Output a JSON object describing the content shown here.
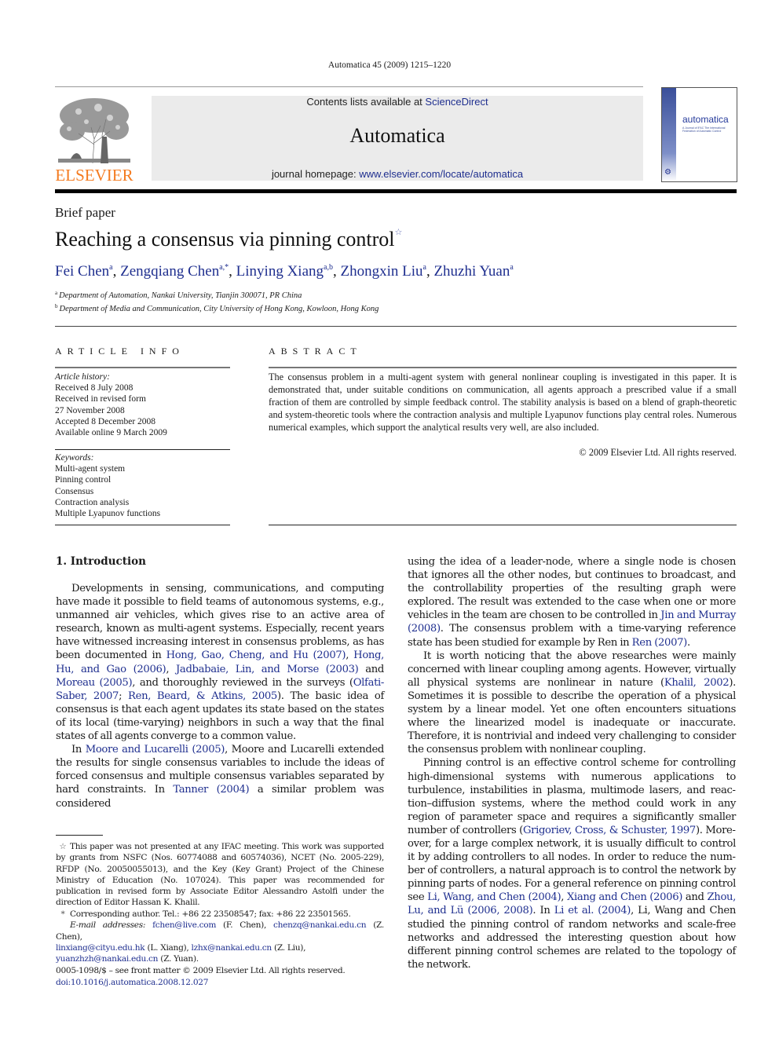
{
  "running_head": "Automatica 45 (2009) 1215–1220",
  "masthead": {
    "publisher_logo_text": "ELSEVIER",
    "contents_prefix": "Contents lists available at ",
    "contents_link": "ScienceDirect",
    "journal_name": "Automatica",
    "homepage_prefix": "journal homepage: ",
    "homepage_link": "www.elsevier.com/locate/automatica",
    "cover_title": "automatica",
    "cover_subtitle": "A Journal of IFAC The International Federation of Automatic Control"
  },
  "article": {
    "type": "Brief paper",
    "title": "Reaching a consensus via pinning control",
    "title_note_mark": "☆",
    "authors": [
      {
        "name": "Fei Chen",
        "sup": "a"
      },
      {
        "name": "Zengqiang Chen",
        "sup": "a,*"
      },
      {
        "name": "Linying Xiang",
        "sup": "a,b"
      },
      {
        "name": "Zhongxin Liu",
        "sup": "a"
      },
      {
        "name": "Zhuzhi Yuan",
        "sup": "a"
      }
    ],
    "affiliations": [
      {
        "mark": "a",
        "text": "Department of Automation, Nankai University, Tianjin 300071, PR China"
      },
      {
        "mark": "b",
        "text": "Department of Media and Communication, City University of Hong Kong, Kowloon, Hong Kong"
      }
    ]
  },
  "article_info": {
    "heading": "ARTICLE INFO",
    "history_label": "Article history:",
    "history": [
      "Received 8 July 2008",
      "Received in revised form",
      "27 November 2008",
      "Accepted 8 December 2008",
      "Available online 9 March 2009"
    ],
    "keywords_label": "Keywords:",
    "keywords": [
      "Multi-agent system",
      "Pinning control",
      "Consensus",
      "Contraction analysis",
      "Multiple Lyapunov functions"
    ]
  },
  "abstract": {
    "heading": "ABSTRACT",
    "text": "The consensus problem in a multi-agent system with general nonlinear coupling is investigated in this paper. It is demonstrated that, under suitable conditions on communication, all agents approach a prescribed value if a small fraction of them are controlled by simple feedback control. The stability analysis is based on a blend of graph-theoretic and system-theoretic tools where the contraction analysis and multiple Lyapunov functions play central roles. Numerous numerical examples, which support the analytical results very well, are also included.",
    "copyright": "© 2009 Elsevier Ltd. All rights reserved."
  },
  "body": {
    "section_heading": "1.  Introduction",
    "left_paragraphs": [
      [
        {
          "t": "Developments in sensing, communications, and computing have made it possible to field teams of autonomous systems, e.g., unmanned air vehicles, which gives rise to an active area of research, known as multi-agent systems. Especially, recent years have witnessed increasing interest in consensus problems, as has been documented in "
        },
        {
          "t": "Hong, Gao, Cheng, and Hu (2007)",
          "link": true
        },
        {
          "t": ", "
        },
        {
          "t": "Hong, Hu, and Gao (2006)",
          "link": true
        },
        {
          "t": ", "
        },
        {
          "t": "Jadbabaie, Lin, and Morse (2003)",
          "link": true
        },
        {
          "t": " and "
        },
        {
          "t": "Moreau (2005)",
          "link": true
        },
        {
          "t": ", and thoroughly reviewed in the surveys ("
        },
        {
          "t": "Olfati-Saber, 2007",
          "link": true
        },
        {
          "t": "; "
        },
        {
          "t": "Ren, Beard, & Atkins, 2005",
          "link": true
        },
        {
          "t": "). The basic idea of consensus is that each agent updates its state based on the states of its local (time-varying) neighbors in such a way that the final states of all agents converge to a common value."
        }
      ],
      [
        {
          "t": "In "
        },
        {
          "t": "Moore and Lucarelli (2005)",
          "link": true
        },
        {
          "t": ", Moore and Lucarelli extended the results for single consensus variables to include the ideas of forced consensus and multiple consensus variables separated by hard constraints. In "
        },
        {
          "t": "Tanner (2004)",
          "link": true
        },
        {
          "t": " a similar problem was considered"
        }
      ]
    ],
    "right_paragraphs": [
      [
        {
          "t": "using the idea of a leader-node, where a single node is chosen that ignores all the other nodes, but continues to broadcast, and the controllability properties of the resulting graph were explored. The result was extended to the case when one or more vehicles in the team are chosen to be controlled in "
        },
        {
          "t": "Jin and Murray (2008)",
          "link": true
        },
        {
          "t": ". The consensus problem with a time-varying reference state has been studied for example by Ren in "
        },
        {
          "t": "Ren (2007)",
          "link": true
        },
        {
          "t": "."
        }
      ],
      [
        {
          "t": "It is worth noticing that the above researches were mainly concerned with linear coupling among agents. However, virtually all physical systems are nonlinear in nature ("
        },
        {
          "t": "Khalil, 2002",
          "link": true
        },
        {
          "t": "). Sometimes it is possible to describe the operation of a physical system by a linear model. Yet one often encounters situations where the linearized model is inadequate or inaccurate. Therefore, it is nontrivial and indeed very challenging to consider the consensus problem with nonlinear coupling."
        }
      ],
      [
        {
          "t": "Pinning control is an effective control scheme for control­ling high-dimensional systems with numerous applications to turbulence, instabilities in plasma, multimode lasers, and reac­tion–diffusion systems, where the method could work in any region of parameter space and requires a significantly smaller number of controllers ("
        },
        {
          "t": "Grigoriev, Cross, & Schuster, 1997",
          "link": true
        },
        {
          "t": "). More­over, for a large complex network, it is usually difficult to control it by adding controllers to all nodes. In order to reduce the num­ber of controllers, a natural approach is to control the network by pinning parts of nodes. For a general reference on pinning control see "
        },
        {
          "t": "Li, Wang, and Chen (2004)",
          "link": true
        },
        {
          "t": ", "
        },
        {
          "t": "Xiang and Chen (2006)",
          "link": true
        },
        {
          "t": " and "
        },
        {
          "t": "Zhou, Lu, and Lü (2006, 2008)",
          "link": true
        },
        {
          "t": ". In "
        },
        {
          "t": "Li et al. (2004)",
          "link": true
        },
        {
          "t": ", Li, Wang and Chen studied the pinning control of random networks and scale-free networks and addressed the interesting question about how different pin­ning control schemes are related to the topology of the network."
        }
      ]
    ]
  },
  "footnotes": {
    "star_mark": "☆",
    "star_text": "This paper was not presented at any IFAC meeting. This work was supported by grants from NSFC (Nos. 60774088 and 60574036), NCET (No. 2005-229), RFDP (No. 20050055013), and the Key (Key Grant) Project of the Chinese Ministry of Education (No. 107024). This paper was recommended for publication in revised form by Associate Editor Alessandro Astolfi under the direction of Editor Hassan K. Khalil.",
    "corr_mark": "*",
    "corr_text": "Corresponding author. Tel.: +86 22 23508547; fax: +86 22 23501565.",
    "email_label": "E-mail addresses:",
    "emails": [
      {
        "email": "fchen@live.com",
        "who": "(F. Chen)"
      },
      {
        "email": "chenzq@nankai.edu.cn",
        "who": "(Z. Chen)"
      },
      {
        "email": "linxiang@cityu.edu.hk",
        "who": "(L. Xiang)"
      },
      {
        "email": "lzhx@nankai.edu.cn",
        "who": "(Z. Liu)"
      },
      {
        "email": "yuanzhzh@nankai.edu.cn",
        "who": "(Z. Yuan)."
      }
    ]
  },
  "front_matter": {
    "issn_line": "0005-1098/$ – see front matter © 2009 Elsevier Ltd. All rights reserved.",
    "doi": "doi:10.1016/j.automatica.2008.12.027"
  },
  "colors": {
    "link": "#1f2f8f",
    "elsevier_orange": "#f47b20",
    "masthead_bg": "#ebebeb"
  }
}
